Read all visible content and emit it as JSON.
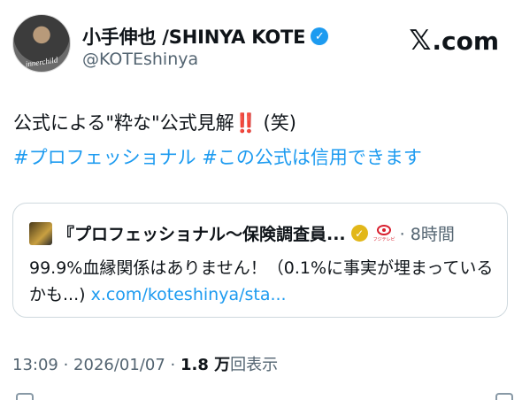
{
  "author": {
    "display_name": "小手伸也 /SHINYA KOTE",
    "handle": "@KOTEshinya",
    "avatar_text": "innerchild"
  },
  "brand": {
    "logo_glyph": "𝕏",
    "logo_text": ".com"
  },
  "tweet": {
    "text_main": "公式による\"粋な\"公式見解",
    "text_emoji": "‼️",
    "text_tail": " (笑)",
    "hashtags": "#プロフェッショナル #この公式は信用できます"
  },
  "quoted": {
    "name": "『プロフェッショナル〜保険調査員...",
    "tv_label": "フジテレビ",
    "time": "· 8時間",
    "text": "99.9%血縁関係はありません！（0.1%に事実が埋まっているかも...) ",
    "link": "x.com/koteshinya/sta..."
  },
  "meta": {
    "timestamp": "13:09 · 2026/01/07 · ",
    "views_count": "1.8 万",
    "views_label": "回表示"
  },
  "colors": {
    "accent": "#1d9bf0",
    "text": "#0f1419",
    "muted": "#536471",
    "border": "#cfd9de",
    "gold": "#e2b719"
  }
}
